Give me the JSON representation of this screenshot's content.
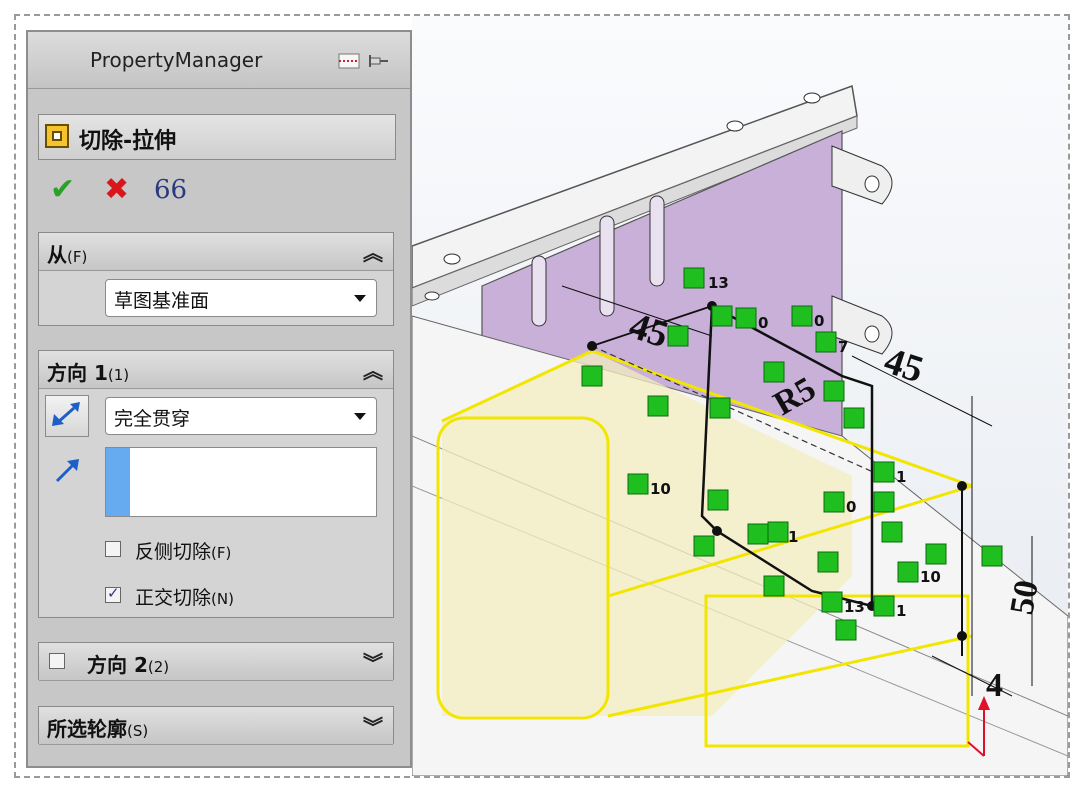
{
  "property_manager": {
    "title": "PropertyManager"
  },
  "feature": {
    "title": "切除-拉伸",
    "help": "?"
  },
  "actions": {
    "ok": "✔",
    "cancel": "✖",
    "preview": "66"
  },
  "from_group": {
    "label": "从",
    "key": "(F)",
    "select_value": "草图基准面"
  },
  "direction1": {
    "label": "方向 1",
    "key": "(1)",
    "end_condition": "完全贯穿",
    "flip_side_label": "反侧切除",
    "flip_side_key": "(F)",
    "flip_side_checked": false,
    "normal_cut_label": "正交切除",
    "normal_cut_key": "(N)",
    "normal_cut_checked": true
  },
  "direction2": {
    "label": "方向 2",
    "key": "(2)",
    "checked": false
  },
  "selected_contours": {
    "label": "所选轮廓",
    "key": "(S)"
  },
  "sketch": {
    "dimensions": [
      "45",
      "45",
      "R5",
      "50",
      "4"
    ],
    "relation_labels": [
      "13",
      "0",
      "0",
      "7",
      "10",
      "1",
      "0",
      "1",
      "10",
      "13",
      "1"
    ]
  },
  "colors": {
    "sketch_highlight": "#f2e600",
    "relation_badge": "#1fbf1f",
    "panel_face": "#c8b0d8",
    "preview_fill": "#f3eec0"
  },
  "icons": [
    "pin-icon",
    "feature-cut-extrude-icon",
    "help-icon",
    "ok-check-icon",
    "cancel-x-icon",
    "preview-glasses-icon",
    "collapse-up-icon",
    "collapse-down-icon",
    "reverse-direction-icon",
    "direction-arrow-icon",
    "select-dropdown-icon"
  ]
}
